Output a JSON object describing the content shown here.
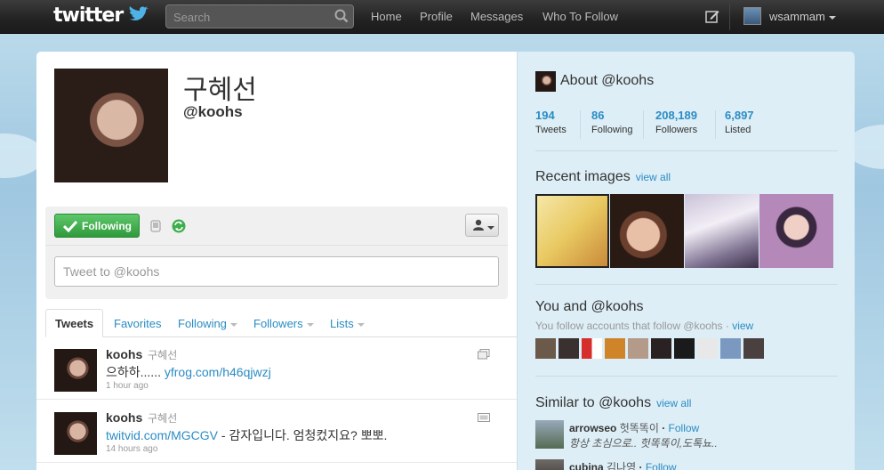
{
  "topbar": {
    "logo": "twitter",
    "search_placeholder": "Search",
    "nav": [
      "Home",
      "Profile",
      "Messages",
      "Who To Follow"
    ],
    "username": "wsammam"
  },
  "profile": {
    "full_name": "구혜선",
    "screen_name": "@koohs",
    "follow_label": "Following",
    "tweet_placeholder": "Tweet to @koohs"
  },
  "tabs": [
    {
      "label": "Tweets",
      "active": true
    },
    {
      "label": "Favorites"
    },
    {
      "label": "Following"
    },
    {
      "label": "Followers"
    },
    {
      "label": "Lists"
    }
  ],
  "tweets": [
    {
      "user": "koohs",
      "full_name": "구혜선",
      "text": "으하하...... ",
      "link": "yfrog.com/h46qjwzj",
      "after": "",
      "time": "1 hour ago",
      "media_icon": "photo-icon"
    },
    {
      "user": "koohs",
      "full_name": "구혜선",
      "text": "",
      "link": "twitvid.com/MGCGV",
      "after": " - 감자입니다. 엄청컸지요? 뽀뽀.",
      "time": "14 hours ago",
      "media_icon": "video-icon"
    }
  ],
  "dashboard": {
    "about_title": "About @koohs",
    "stats": [
      {
        "num": "194",
        "label": "Tweets"
      },
      {
        "num": "86",
        "label": "Following"
      },
      {
        "num": "208,189",
        "label": "Followers"
      },
      {
        "num": "6,897",
        "label": "Listed"
      }
    ],
    "recent_images_title": "Recent images",
    "view_all": "view all",
    "you_and_title": "You and @koohs",
    "you_follow_text": "You follow accounts that follow @koohs ·",
    "view": "view",
    "similar_title": "Similar to @koohs",
    "similar": [
      {
        "user": "arrowseo",
        "full_name": "헛똑똑이",
        "follow": "Follow",
        "bio": "항상 초심으로.. 헛똑똑이,도톡뇨.."
      },
      {
        "user": "cubina",
        "full_name": "김나영",
        "follow": "Follow",
        "bio": ""
      }
    ]
  },
  "colors": {
    "link": "#2a8cc4",
    "follow_green": "#3fae4c",
    "topbar": "#222222",
    "background": "#c0deed"
  }
}
